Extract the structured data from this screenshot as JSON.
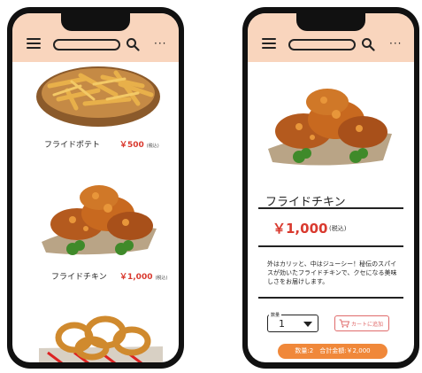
{
  "colors": {
    "header_bg": "#f9d5bd",
    "price": "#d93a2f",
    "cart": "#e06b6b",
    "total_btn": "#f0883a"
  },
  "list_screen": {
    "items": [
      {
        "name": "フライドポテト",
        "price": "￥500",
        "tax": "(税込)"
      },
      {
        "name": "フライドチキン",
        "price": "￥1,000",
        "tax": "(税込)"
      }
    ]
  },
  "detail_screen": {
    "title": "フライドチキン",
    "price": "￥1,000",
    "tax": "(税込)",
    "description": "外はカリッと、中はジューシー！秘伝のスパイスが効いたフライドチキンで、クセになる美味しさをお届けします。",
    "quantity_label": "数量",
    "quantity_value": "1",
    "add_to_cart_label": "カートに追加",
    "total_label": "数量:2　合計金額:￥2,000"
  },
  "icons": {
    "menu": "menu-icon",
    "search": "search-icon",
    "more": "more-icon",
    "cart": "cart-icon",
    "dropdown": "chevron-down-icon"
  }
}
